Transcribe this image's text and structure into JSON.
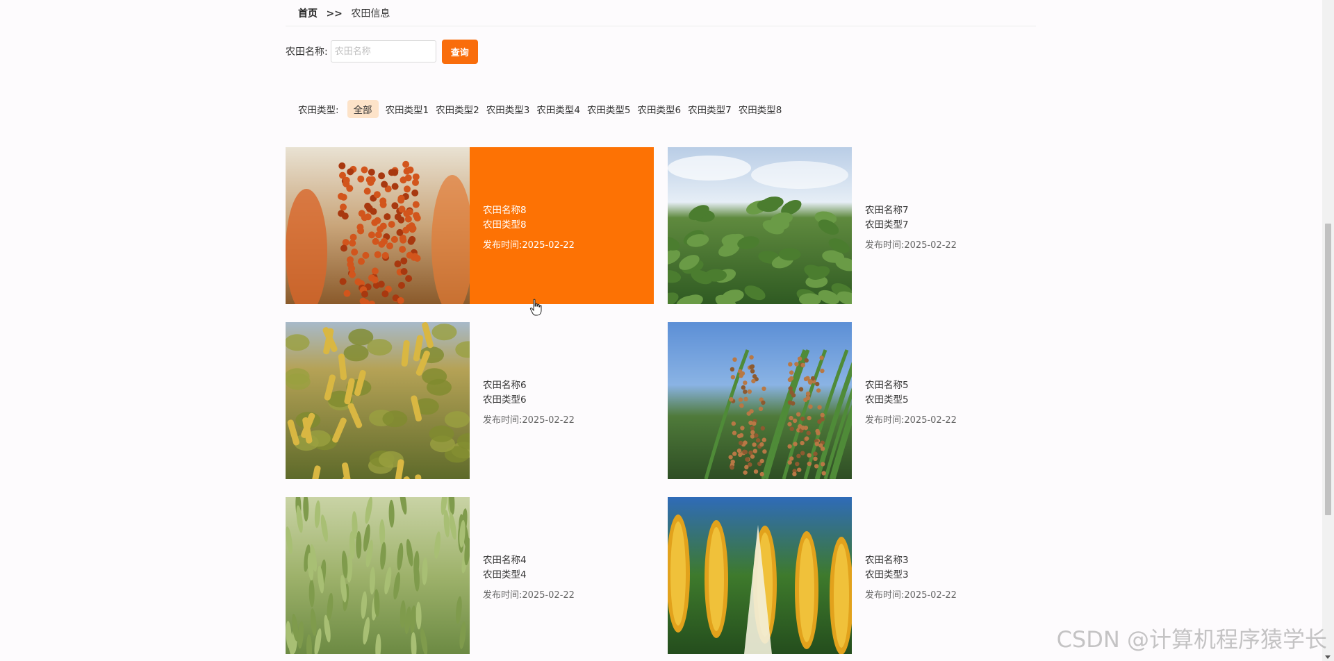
{
  "breadcrumb": {
    "home": "首页",
    "separator": ">>",
    "current": "农田信息"
  },
  "search": {
    "label": "农田名称:",
    "placeholder": "农田名称",
    "value": "",
    "button": "查询"
  },
  "filter": {
    "label": "农田类型:",
    "tags": [
      "全部",
      "农田类型1",
      "农田类型2",
      "农田类型3",
      "农田类型4",
      "农田类型5",
      "农田类型6",
      "农田类型7",
      "农田类型8"
    ],
    "active_index": 0
  },
  "cards": [
    {
      "name": "农田名称8",
      "type": "农田类型8",
      "date": "发布时间:2025-02-22",
      "image": "sorghum-image",
      "hovered": true
    },
    {
      "name": "农田名称7",
      "type": "农田类型7",
      "date": "发布时间:2025-02-22",
      "image": "soybean-field-image",
      "hovered": false
    },
    {
      "name": "农田名称6",
      "type": "农田类型6",
      "date": "发布时间:2025-02-22",
      "image": "soybean-pods-image",
      "hovered": false
    },
    {
      "name": "农田名称5",
      "type": "农田类型5",
      "date": "发布时间:2025-02-22",
      "image": "millet-image",
      "hovered": false
    },
    {
      "name": "农田名称4",
      "type": "农田类型4",
      "date": "发布时间:2025-02-22",
      "image": "wheat-image",
      "hovered": false
    },
    {
      "name": "农田名称3",
      "type": "农田类型3",
      "date": "发布时间:2025-02-22",
      "image": "corn-image",
      "hovered": false
    }
  ],
  "colors": {
    "accent": "#f96d0c",
    "hover_panel": "#fd7204",
    "active_tag_bg": "#fde3c9"
  },
  "watermark": "CSDN @计算机程序猿学长"
}
